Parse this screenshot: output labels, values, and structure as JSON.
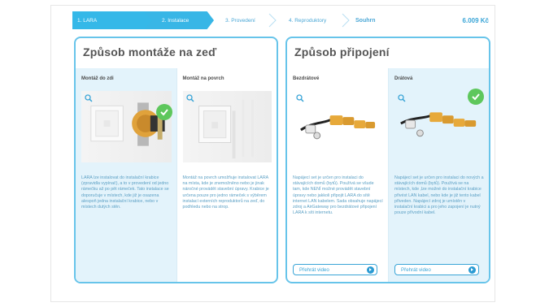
{
  "steps": [
    {
      "label": "1. LARA"
    },
    {
      "label": "2. Instalace"
    },
    {
      "label": "3. Provedení"
    },
    {
      "label": "4. Reproduktory"
    },
    {
      "label": "Souhrn"
    }
  ],
  "price": "6.009 Kč",
  "mounting": {
    "title": "Způsob montáže na zeď",
    "options": [
      {
        "title": "Montáž do zdi",
        "selected": true,
        "description": "LARA lze instalovat do instalační krabice (zpravidla vypínač), a to v provedení od jedno rámečku až po pět rámeček. Tato instalace se doporučuje v místech, kde již je osazena alespoň jedna instalační krabice, nebo v místech dutých stěn."
      },
      {
        "title": "Montáž na povrch",
        "selected": false,
        "description": "Montáž na povrch umožňuje instalovat LARA na místa, kde je znemožněno nebo je jinak náročné provádět stavební úpravy. Krabice je určena pouze pro jedno rámeček s výběrem instalací externích reproduktorů na zeď, do podhledu nebo na strop."
      }
    ]
  },
  "connection": {
    "title": "Způsob připojení",
    "options": [
      {
        "title": "Bezdrátové",
        "selected": false,
        "description": "Napájecí set je určen pro instalaci do stávajících domů (bytů). Používá se všude tam, kde NENÍ možné provádět stavební úpravy nebo jakkoli připojit LARA do sítě internet LAN kabelem. Sada obsahuje napájecí zdroj a AirGateway pro bezdrátové připojení LARA k síti internetu.",
        "video_label": "Přehrát video"
      },
      {
        "title": "Drátová",
        "selected": true,
        "description": "Napájecí set je určen pro instalaci do nových a stávajících domů (bytů). Používá se na místech, kde ,lze možné do instalační krabice přivést LAN kabel, nebo kde je již tento kabel přiveden. Napájecí zdroj je umístěn v instalační krabici a pro jeho zapojení je nutný pouze přívodní kabel.",
        "video_label": "Přehrát video"
      }
    ]
  },
  "colors": {
    "accent": "#35b8e8",
    "selected_bg": "#e3f3fb",
    "check": "#5ec75c"
  },
  "icons": {
    "zoom": "magnifier-icon",
    "check": "check-circle-icon",
    "play": "play-circle-icon"
  }
}
